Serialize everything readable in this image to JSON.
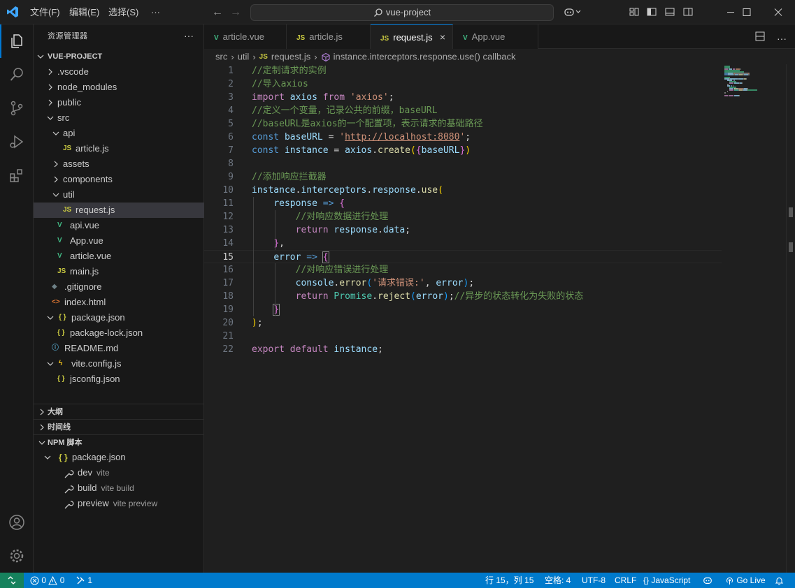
{
  "titlebar": {
    "menu": [
      "文件(F)",
      "编辑(E)",
      "选择(S)"
    ],
    "more": "···",
    "search_text": "vue-project"
  },
  "sidebar": {
    "title": "资源管理器",
    "more": "···",
    "root": "VUE-PROJECT",
    "tree": [
      {
        "label": ".vscode",
        "kind": "folder",
        "open": false,
        "depth": 1
      },
      {
        "label": "node_modules",
        "kind": "folder",
        "open": false,
        "depth": 1
      },
      {
        "label": "public",
        "kind": "folder",
        "open": false,
        "depth": 1
      },
      {
        "label": "src",
        "kind": "folder",
        "open": true,
        "depth": 1
      },
      {
        "label": "api",
        "kind": "folder",
        "open": true,
        "depth": 2
      },
      {
        "label": "article.js",
        "kind": "js",
        "depth": 3
      },
      {
        "label": "assets",
        "kind": "folder",
        "open": false,
        "depth": 2
      },
      {
        "label": "components",
        "kind": "folder",
        "open": false,
        "depth": 2
      },
      {
        "label": "util",
        "kind": "folder",
        "open": true,
        "depth": 2
      },
      {
        "label": "request.js",
        "kind": "js",
        "depth": 3,
        "selected": true
      },
      {
        "label": "api.vue",
        "kind": "vue",
        "depth": 2
      },
      {
        "label": "App.vue",
        "kind": "vue",
        "depth": 2
      },
      {
        "label": "article.vue",
        "kind": "vue",
        "depth": 2
      },
      {
        "label": "main.js",
        "kind": "js",
        "depth": 2
      },
      {
        "label": ".gitignore",
        "kind": "git",
        "depth": 1
      },
      {
        "label": "index.html",
        "kind": "html",
        "depth": 1
      },
      {
        "label": "package.json",
        "kind": "json",
        "open": true,
        "depth": 1,
        "chev": true
      },
      {
        "label": "package-lock.json",
        "kind": "json",
        "depth": 2
      },
      {
        "label": "README.md",
        "kind": "info",
        "depth": 1
      },
      {
        "label": "vite.config.js",
        "kind": "vite",
        "open": true,
        "depth": 1,
        "chev": true
      },
      {
        "label": "jsconfig.json",
        "kind": "json",
        "depth": 2
      }
    ],
    "sections": [
      "大纲",
      "时间线",
      "NPM 脚本"
    ],
    "npm": {
      "file": "package.json",
      "scripts": [
        {
          "name": "dev",
          "cmd": "vite"
        },
        {
          "name": "build",
          "cmd": "vite build"
        },
        {
          "name": "preview",
          "cmd": "vite preview"
        }
      ]
    }
  },
  "tabs": [
    {
      "label": "article.vue",
      "kind": "vue"
    },
    {
      "label": "article.js",
      "kind": "js"
    },
    {
      "label": "request.js",
      "kind": "js",
      "active": true
    },
    {
      "label": "App.vue",
      "kind": "vue"
    }
  ],
  "breadcrumb": [
    "src",
    "util",
    "request.js",
    "instance.interceptors.response.use() callback"
  ],
  "code": {
    "current_line": 15,
    "lines": [
      [
        [
          "//定制请求的实例",
          "cm"
        ]
      ],
      [
        [
          "//导入axios",
          "cm"
        ]
      ],
      [
        [
          "import",
          "kw2"
        ],
        [
          " ",
          "pl"
        ],
        [
          "axios",
          "var"
        ],
        [
          " ",
          "pl"
        ],
        [
          "from",
          "kw2"
        ],
        [
          " ",
          "pl"
        ],
        [
          "'axios'",
          "str"
        ],
        [
          ";",
          "pl"
        ]
      ],
      [
        [
          "//定义一个变量，记录公共的前缀，baseURL",
          "cm"
        ]
      ],
      [
        [
          "//baseURL是axios的一个配置项，表示请求的基础路径",
          "cm"
        ]
      ],
      [
        [
          "const",
          "kw"
        ],
        [
          " ",
          "pl"
        ],
        [
          "baseURL",
          "var"
        ],
        [
          " = ",
          "pl"
        ],
        [
          "'",
          "str"
        ],
        [
          "http://localhost:8080",
          "url"
        ],
        [
          "'",
          "str"
        ],
        [
          ";",
          "pl"
        ]
      ],
      [
        [
          "const",
          "kw"
        ],
        [
          " ",
          "pl"
        ],
        [
          "instance",
          "var"
        ],
        [
          " = ",
          "pl"
        ],
        [
          "axios",
          "var"
        ],
        [
          ".",
          "pl"
        ],
        [
          "create",
          "fn"
        ],
        [
          "(",
          "b1"
        ],
        [
          "{",
          "b2"
        ],
        [
          "baseURL",
          "var"
        ],
        [
          "}",
          "b2"
        ],
        [
          ")",
          "b1"
        ]
      ],
      [],
      [
        [
          "//添加响应拦截器",
          "cm"
        ]
      ],
      [
        [
          "instance",
          "var"
        ],
        [
          ".",
          "pl"
        ],
        [
          "interceptors",
          "var"
        ],
        [
          ".",
          "pl"
        ],
        [
          "response",
          "var"
        ],
        [
          ".",
          "pl"
        ],
        [
          "use",
          "fn"
        ],
        [
          "(",
          "b1"
        ]
      ],
      [
        [
          "    ",
          "pl"
        ],
        [
          "response",
          "var"
        ],
        [
          " ",
          "pl"
        ],
        [
          "=>",
          "kw"
        ],
        [
          " ",
          "pl"
        ],
        [
          "{",
          "b2"
        ]
      ],
      [
        [
          "        ",
          "pl"
        ],
        [
          "//对响应数据进行处理",
          "cm"
        ]
      ],
      [
        [
          "        ",
          "pl"
        ],
        [
          "return",
          "kw2"
        ],
        [
          " ",
          "pl"
        ],
        [
          "response",
          "var"
        ],
        [
          ".",
          "pl"
        ],
        [
          "data",
          "var"
        ],
        [
          ";",
          "pl"
        ]
      ],
      [
        [
          "    ",
          "pl"
        ],
        [
          "}",
          "b2"
        ],
        [
          ",",
          "pl"
        ]
      ],
      [
        [
          "    ",
          "pl"
        ],
        [
          "error",
          "var"
        ],
        [
          " ",
          "pl"
        ],
        [
          "=>",
          "kw"
        ],
        [
          " ",
          "pl"
        ],
        [
          "{",
          "b2m"
        ]
      ],
      [
        [
          "        ",
          "pl"
        ],
        [
          "//对响应错误进行处理",
          "cm"
        ]
      ],
      [
        [
          "        ",
          "pl"
        ],
        [
          "console",
          "var"
        ],
        [
          ".",
          "pl"
        ],
        [
          "error",
          "fn"
        ],
        [
          "(",
          "b3"
        ],
        [
          "'请求错误:'",
          "str"
        ],
        [
          ", ",
          "pl"
        ],
        [
          "error",
          "var"
        ],
        [
          ")",
          "b3"
        ],
        [
          ";",
          "pl"
        ]
      ],
      [
        [
          "        ",
          "pl"
        ],
        [
          "return",
          "kw2"
        ],
        [
          " ",
          "pl"
        ],
        [
          "Promise",
          "cls"
        ],
        [
          ".",
          "pl"
        ],
        [
          "reject",
          "fn"
        ],
        [
          "(",
          "b3"
        ],
        [
          "error",
          "var"
        ],
        [
          ")",
          "b3"
        ],
        [
          ";",
          "pl"
        ],
        [
          "//异步的状态转化为失败的状态",
          "cm"
        ]
      ],
      [
        [
          "    ",
          "pl"
        ],
        [
          "}",
          "b2m"
        ]
      ],
      [
        [
          ")",
          "b1"
        ],
        [
          ";",
          "pl"
        ]
      ],
      [],
      [
        [
          "export",
          "kw2"
        ],
        [
          " ",
          "pl"
        ],
        [
          "default",
          "kw2"
        ],
        [
          " ",
          "pl"
        ],
        [
          "instance",
          "var"
        ],
        [
          ";",
          "pl"
        ]
      ]
    ]
  },
  "statusbar": {
    "errors": "0",
    "warnings": "0",
    "ports": "1",
    "position": "行 15，列 15",
    "spaces": "空格: 4",
    "encoding": "UTF-8",
    "eol": "CRLF",
    "language": "JavaScript",
    "golive": "Go Live"
  },
  "colors": {
    "accent": "#0078d4",
    "statusbar": "#007acc",
    "js": "#cbcb41",
    "vue": "#41b883",
    "json": "#cbcb41",
    "html": "#e37933",
    "info": "#519aba",
    "git": "#6d8086"
  }
}
